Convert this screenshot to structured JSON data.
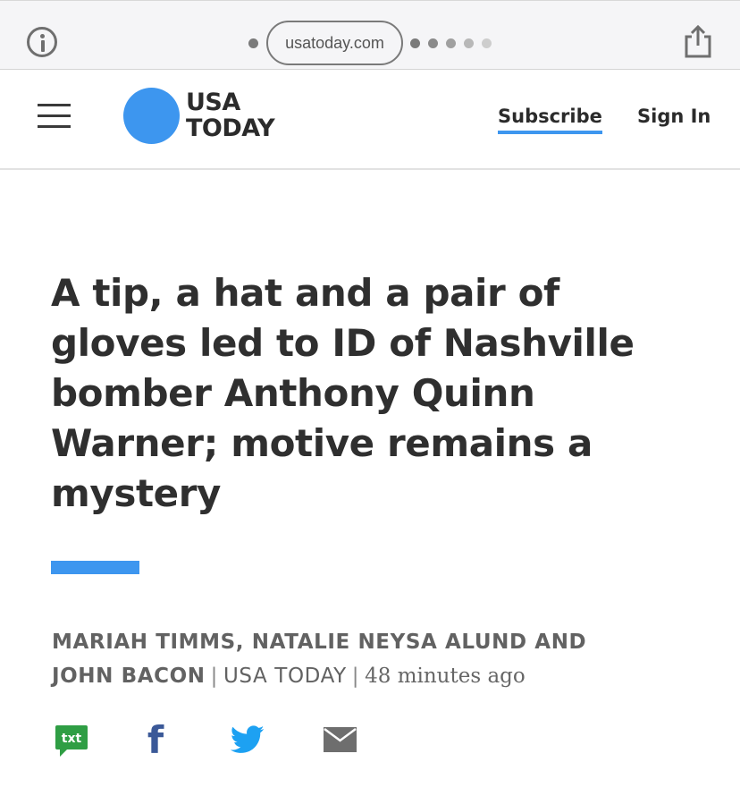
{
  "browser": {
    "url": "usatoday.com"
  },
  "header": {
    "logo_line1": "USA",
    "logo_line2": "TODAY",
    "subscribe_label": "Subscribe",
    "signin_label": "Sign In",
    "accent_color": "#3d96ef"
  },
  "article": {
    "headline": "A tip, a hat and a pair of gloves led to ID of Nashville bomber Anthony Quinn Warner; motive remains a mystery",
    "authors_line1": "MARIAH TIMMS, NATALIE NEYSA ALUND AND",
    "authors_line2": "JOHN BACON",
    "publication": "USA TODAY",
    "timestamp": "48 minutes ago",
    "separator": "|"
  },
  "share": {
    "txt_label": "txt",
    "facebook_glyph": "f",
    "icons": [
      "text-message-icon",
      "facebook-icon",
      "twitter-icon",
      "email-icon"
    ]
  }
}
